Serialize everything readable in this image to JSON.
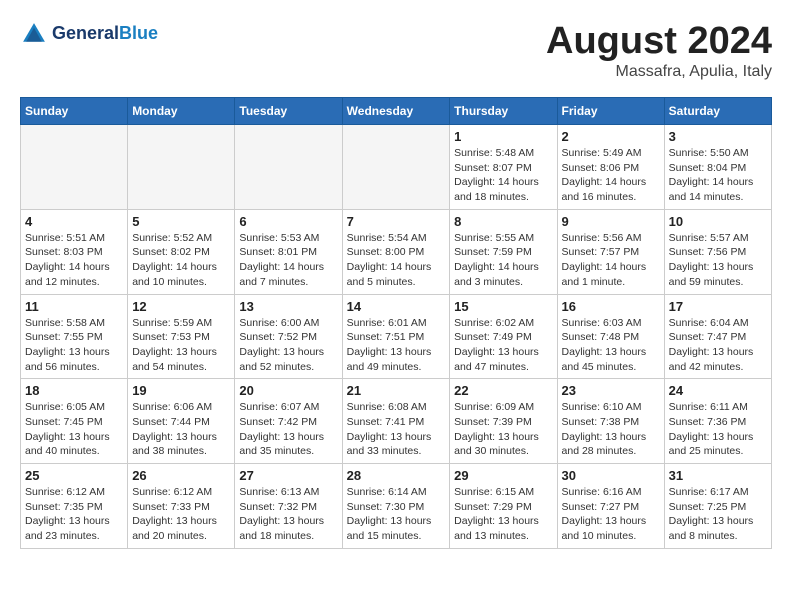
{
  "logo": {
    "line1": "General",
    "line2": "Blue"
  },
  "title": "August 2024",
  "subtitle": "Massafra, Apulia, Italy",
  "weekdays": [
    "Sunday",
    "Monday",
    "Tuesday",
    "Wednesday",
    "Thursday",
    "Friday",
    "Saturday"
  ],
  "weeks": [
    [
      {
        "day": "",
        "info": "",
        "empty": true
      },
      {
        "day": "",
        "info": "",
        "empty": true
      },
      {
        "day": "",
        "info": "",
        "empty": true
      },
      {
        "day": "",
        "info": "",
        "empty": true
      },
      {
        "day": "1",
        "info": "Sunrise: 5:48 AM\nSunset: 8:07 PM\nDaylight: 14 hours\nand 18 minutes."
      },
      {
        "day": "2",
        "info": "Sunrise: 5:49 AM\nSunset: 8:06 PM\nDaylight: 14 hours\nand 16 minutes."
      },
      {
        "day": "3",
        "info": "Sunrise: 5:50 AM\nSunset: 8:04 PM\nDaylight: 14 hours\nand 14 minutes."
      }
    ],
    [
      {
        "day": "4",
        "info": "Sunrise: 5:51 AM\nSunset: 8:03 PM\nDaylight: 14 hours\nand 12 minutes."
      },
      {
        "day": "5",
        "info": "Sunrise: 5:52 AM\nSunset: 8:02 PM\nDaylight: 14 hours\nand 10 minutes."
      },
      {
        "day": "6",
        "info": "Sunrise: 5:53 AM\nSunset: 8:01 PM\nDaylight: 14 hours\nand 7 minutes."
      },
      {
        "day": "7",
        "info": "Sunrise: 5:54 AM\nSunset: 8:00 PM\nDaylight: 14 hours\nand 5 minutes."
      },
      {
        "day": "8",
        "info": "Sunrise: 5:55 AM\nSunset: 7:59 PM\nDaylight: 14 hours\nand 3 minutes."
      },
      {
        "day": "9",
        "info": "Sunrise: 5:56 AM\nSunset: 7:57 PM\nDaylight: 14 hours\nand 1 minute."
      },
      {
        "day": "10",
        "info": "Sunrise: 5:57 AM\nSunset: 7:56 PM\nDaylight: 13 hours\nand 59 minutes."
      }
    ],
    [
      {
        "day": "11",
        "info": "Sunrise: 5:58 AM\nSunset: 7:55 PM\nDaylight: 13 hours\nand 56 minutes."
      },
      {
        "day": "12",
        "info": "Sunrise: 5:59 AM\nSunset: 7:53 PM\nDaylight: 13 hours\nand 54 minutes."
      },
      {
        "day": "13",
        "info": "Sunrise: 6:00 AM\nSunset: 7:52 PM\nDaylight: 13 hours\nand 52 minutes."
      },
      {
        "day": "14",
        "info": "Sunrise: 6:01 AM\nSunset: 7:51 PM\nDaylight: 13 hours\nand 49 minutes."
      },
      {
        "day": "15",
        "info": "Sunrise: 6:02 AM\nSunset: 7:49 PM\nDaylight: 13 hours\nand 47 minutes."
      },
      {
        "day": "16",
        "info": "Sunrise: 6:03 AM\nSunset: 7:48 PM\nDaylight: 13 hours\nand 45 minutes."
      },
      {
        "day": "17",
        "info": "Sunrise: 6:04 AM\nSunset: 7:47 PM\nDaylight: 13 hours\nand 42 minutes."
      }
    ],
    [
      {
        "day": "18",
        "info": "Sunrise: 6:05 AM\nSunset: 7:45 PM\nDaylight: 13 hours\nand 40 minutes."
      },
      {
        "day": "19",
        "info": "Sunrise: 6:06 AM\nSunset: 7:44 PM\nDaylight: 13 hours\nand 38 minutes."
      },
      {
        "day": "20",
        "info": "Sunrise: 6:07 AM\nSunset: 7:42 PM\nDaylight: 13 hours\nand 35 minutes."
      },
      {
        "day": "21",
        "info": "Sunrise: 6:08 AM\nSunset: 7:41 PM\nDaylight: 13 hours\nand 33 minutes."
      },
      {
        "day": "22",
        "info": "Sunrise: 6:09 AM\nSunset: 7:39 PM\nDaylight: 13 hours\nand 30 minutes."
      },
      {
        "day": "23",
        "info": "Sunrise: 6:10 AM\nSunset: 7:38 PM\nDaylight: 13 hours\nand 28 minutes."
      },
      {
        "day": "24",
        "info": "Sunrise: 6:11 AM\nSunset: 7:36 PM\nDaylight: 13 hours\nand 25 minutes."
      }
    ],
    [
      {
        "day": "25",
        "info": "Sunrise: 6:12 AM\nSunset: 7:35 PM\nDaylight: 13 hours\nand 23 minutes."
      },
      {
        "day": "26",
        "info": "Sunrise: 6:12 AM\nSunset: 7:33 PM\nDaylight: 13 hours\nand 20 minutes."
      },
      {
        "day": "27",
        "info": "Sunrise: 6:13 AM\nSunset: 7:32 PM\nDaylight: 13 hours\nand 18 minutes."
      },
      {
        "day": "28",
        "info": "Sunrise: 6:14 AM\nSunset: 7:30 PM\nDaylight: 13 hours\nand 15 minutes."
      },
      {
        "day": "29",
        "info": "Sunrise: 6:15 AM\nSunset: 7:29 PM\nDaylight: 13 hours\nand 13 minutes."
      },
      {
        "day": "30",
        "info": "Sunrise: 6:16 AM\nSunset: 7:27 PM\nDaylight: 13 hours\nand 10 minutes."
      },
      {
        "day": "31",
        "info": "Sunrise: 6:17 AM\nSunset: 7:25 PM\nDaylight: 13 hours\nand 8 minutes."
      }
    ]
  ]
}
